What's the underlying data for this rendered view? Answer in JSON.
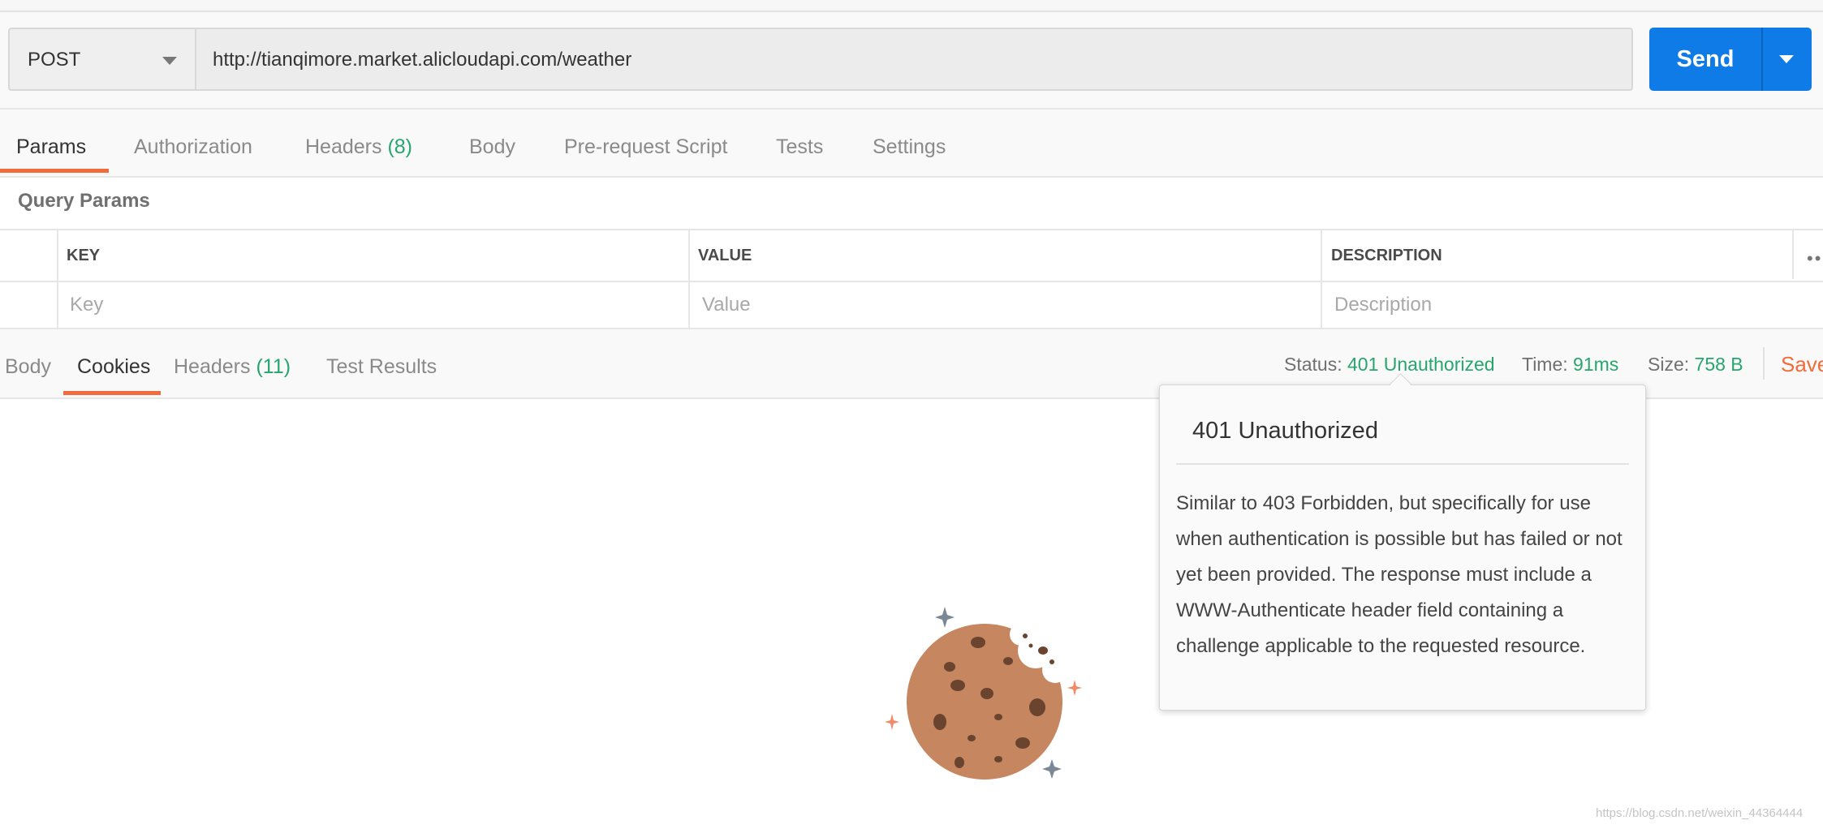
{
  "request": {
    "method": "POST",
    "url": "http://tianqimore.market.alicloudapi.com/weather",
    "send_label": "Send"
  },
  "request_tabs": [
    {
      "label": "Params",
      "count": ""
    },
    {
      "label": "Authorization",
      "count": ""
    },
    {
      "label": "Headers",
      "count": "(8)"
    },
    {
      "label": "Body",
      "count": ""
    },
    {
      "label": "Pre-request Script",
      "count": ""
    },
    {
      "label": "Tests",
      "count": ""
    },
    {
      "label": "Settings",
      "count": ""
    }
  ],
  "query_params": {
    "title": "Query Params",
    "headers": {
      "key": "KEY",
      "value": "VALUE",
      "description": "DESCRIPTION"
    },
    "placeholders": {
      "key": "Key",
      "value": "Value",
      "description": "Description"
    }
  },
  "response_tabs": [
    {
      "label": "Body",
      "count": ""
    },
    {
      "label": "Cookies",
      "count": ""
    },
    {
      "label": "Headers",
      "count": "(11)"
    },
    {
      "label": "Test Results",
      "count": ""
    }
  ],
  "response_meta": {
    "status_label": "Status:",
    "status_value": "401 Unauthorized",
    "time_label": "Time:",
    "time_value": "91ms",
    "size_label": "Size:",
    "size_value": "758 B",
    "save_label": "Save"
  },
  "tooltip": {
    "title": "401 Unauthorized",
    "body": "Similar to 403 Forbidden, but specifically for use when authentication is possible but has failed or not yet been provided. The response must include a WWW-Authenticate header field containing a challenge applicable to the requested resource."
  },
  "watermark": "https://blog.csdn.net/weixin_44364444",
  "colors": {
    "accent_orange": "#f26b3a",
    "send_blue": "#0f7be6",
    "success_green": "#26a56d"
  }
}
